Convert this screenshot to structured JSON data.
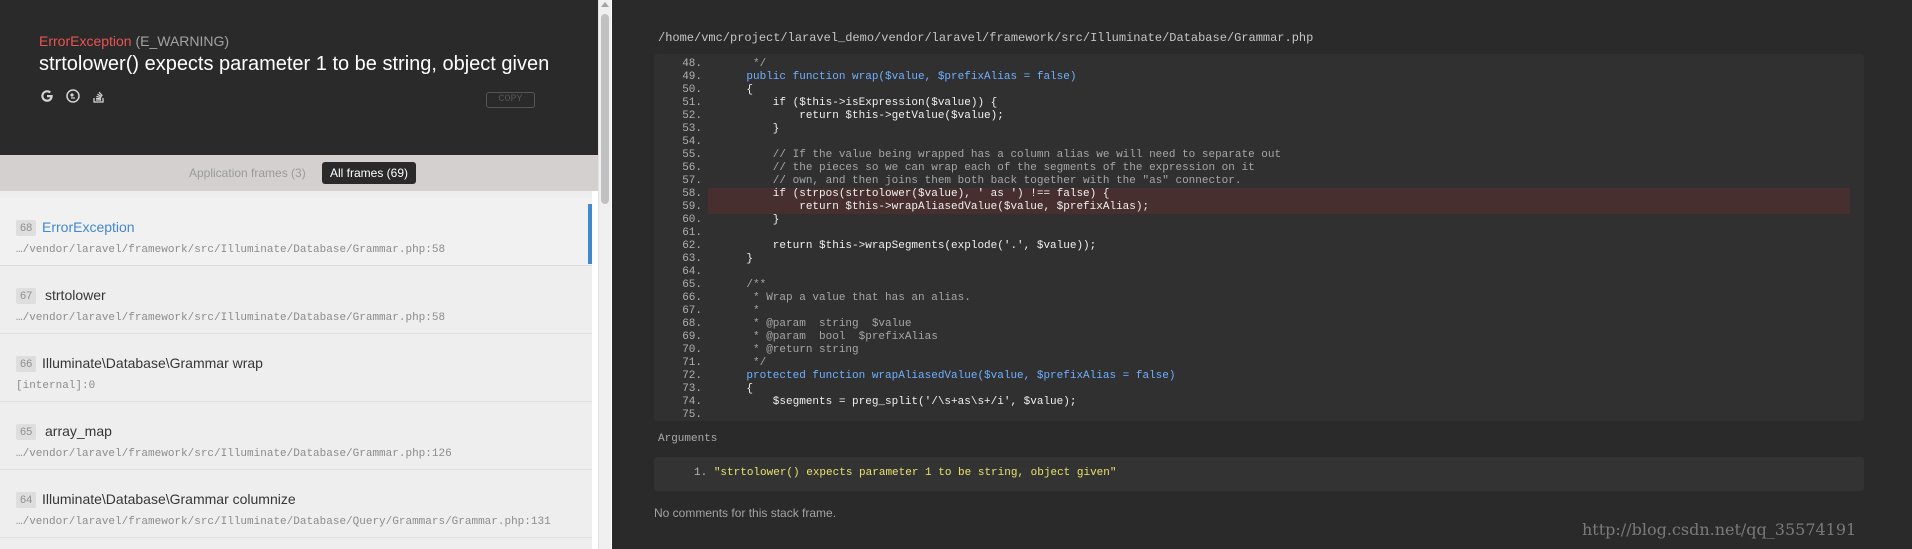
{
  "exception": {
    "class": "ErrorException",
    "type": "(E_WARNING)",
    "message": "strtolower() expects parameter 1 to be string, object given",
    "copy_label": "COPY",
    "icons": [
      "google-icon",
      "duckduckgo-icon",
      "stackoverflow-icon"
    ]
  },
  "tabs": {
    "app": "Application frames (3)",
    "all": "All frames (69)"
  },
  "frames": [
    {
      "index": "68",
      "title": "ErrorException",
      "file": "…/vendor/laravel/framework/src/Illuminate/Database/Grammar.php:58",
      "active": true
    },
    {
      "index": "67",
      "title": "strtolower",
      "file": "…/vendor/laravel/framework/src/Illuminate/Database/Grammar.php:58",
      "active": false
    },
    {
      "index": "66",
      "title": "Illuminate\\Database\\Grammar wrap",
      "file": "[internal]:0",
      "active": false
    },
    {
      "index": "65",
      "title": "array_map",
      "file": "…/vendor/laravel/framework/src/Illuminate/Database/Grammar.php:126",
      "active": false
    },
    {
      "index": "64",
      "title": "Illuminate\\Database\\Grammar columnize",
      "file": "…/vendor/laravel/framework/src/Illuminate/Database/Query/Grammars/Grammar.php:131",
      "active": false
    }
  ],
  "code": {
    "file_path": "/home/vmc/project/laravel_demo/vendor/laravel/framework/src/Illuminate/Database/Grammar.php",
    "lines": [
      {
        "n": "48.",
        "text": "     */"
      },
      {
        "n": "49.",
        "text": "    public function wrap($value, $prefixAlias = false)"
      },
      {
        "n": "50.",
        "text": "    {"
      },
      {
        "n": "51.",
        "text": "        if ($this->isExpression($value)) {"
      },
      {
        "n": "52.",
        "text": "            return $this->getValue($value);"
      },
      {
        "n": "53.",
        "text": "        }"
      },
      {
        "n": "54.",
        "text": ""
      },
      {
        "n": "55.",
        "text": "        // If the value being wrapped has a column alias we will need to separate out"
      },
      {
        "n": "56.",
        "text": "        // the pieces so we can wrap each of the segments of the expression on it"
      },
      {
        "n": "57.",
        "text": "        // own, and then joins them both back together with the \"as\" connector."
      },
      {
        "n": "58.",
        "text": "        if (strpos(strtolower($value), ' as ') !== false) {",
        "hl": true
      },
      {
        "n": "59.",
        "text": "            return $this->wrapAliasedValue($value, $prefixAlias);",
        "hl": true
      },
      {
        "n": "60.",
        "text": "        }"
      },
      {
        "n": "61.",
        "text": ""
      },
      {
        "n": "62.",
        "text": "        return $this->wrapSegments(explode('.', $value));"
      },
      {
        "n": "63.",
        "text": "    }"
      },
      {
        "n": "64.",
        "text": ""
      },
      {
        "n": "65.",
        "text": "    /**"
      },
      {
        "n": "66.",
        "text": "     * Wrap a value that has an alias."
      },
      {
        "n": "67.",
        "text": "     *"
      },
      {
        "n": "68.",
        "text": "     * @param  string  $value"
      },
      {
        "n": "69.",
        "text": "     * @param  bool  $prefixAlias"
      },
      {
        "n": "70.",
        "text": "     * @return string"
      },
      {
        "n": "71.",
        "text": "     */"
      },
      {
        "n": "72.",
        "text": "    protected function wrapAliasedValue($value, $prefixAlias = false)"
      },
      {
        "n": "73.",
        "text": "    {"
      },
      {
        "n": "74.",
        "text": "        $segments = preg_split('/\\s+as\\s+/i', $value);"
      },
      {
        "n": "75.",
        "text": ""
      }
    ]
  },
  "arguments": {
    "label": "Arguments",
    "items": [
      {
        "n": "1.",
        "text": "\"strtolower() expects parameter 1 to be string, object given\""
      }
    ]
  },
  "no_comments": "No comments for this stack frame.",
  "watermark": "http://blog.csdn.net/qq_35574191",
  "colors": {
    "accent": "#4288ce",
    "error": "#e95353",
    "highlight": "#482f2f"
  }
}
